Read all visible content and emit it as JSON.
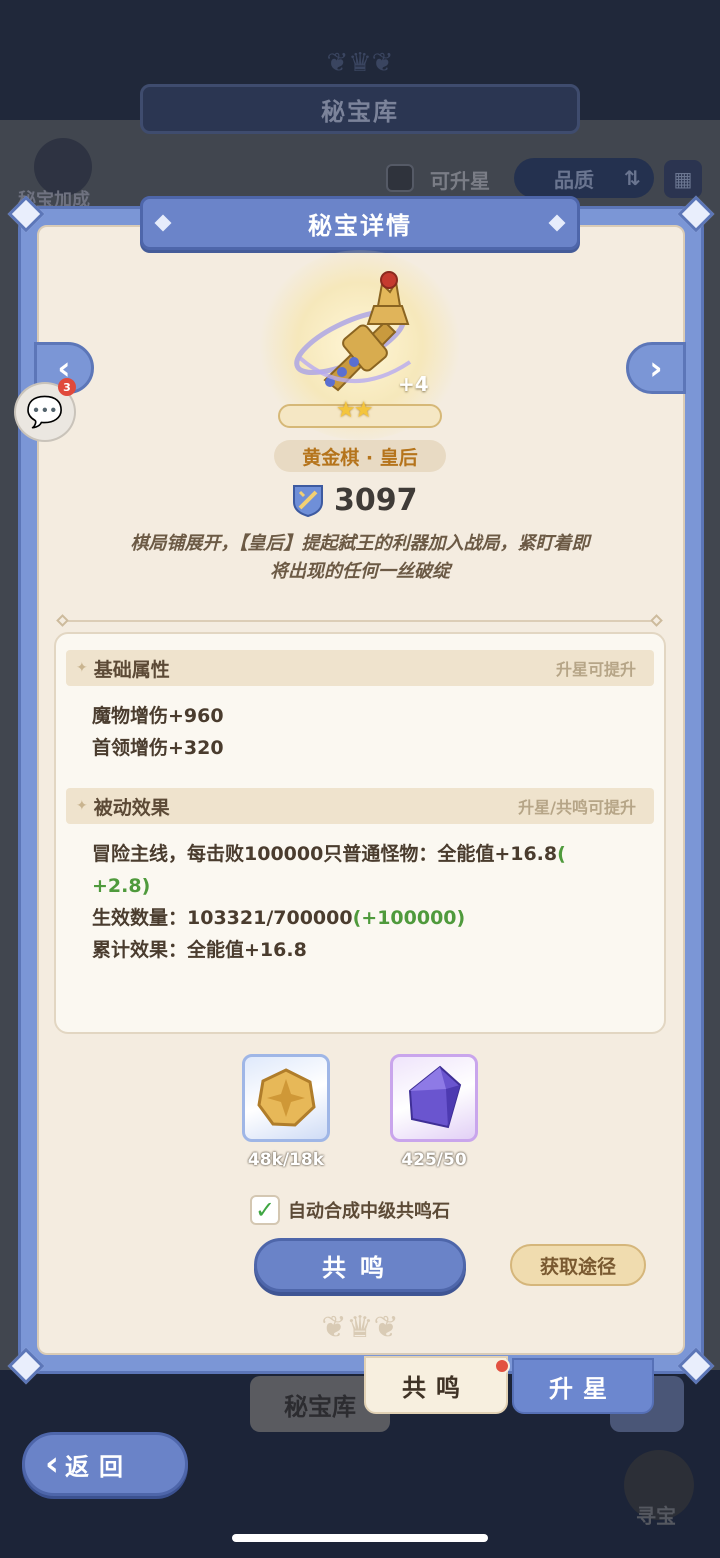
{
  "background": {
    "title": "秘宝库",
    "bonus_label": "秘宝加成",
    "filter_label": "可升星",
    "sort_label": "品质",
    "tab_left_label": "秘宝库",
    "hunt_label": "寻宝"
  },
  "modal": {
    "title": "秘宝详情",
    "item": {
      "name": "黄金棋 · 皇后",
      "level": "+4",
      "stars": "★★",
      "power": "3097",
      "description_line1": "棋局铺展开，【皇后】提起弑王的利器加入战局，紧盯着即",
      "description_line2": "将出现的任何一丝破绽"
    },
    "base_section": {
      "title": "基础属性",
      "hint": "升星可提升",
      "lines": [
        "魔物增伤+960",
        "首领增伤+320"
      ]
    },
    "passive_section": {
      "title": "被动效果",
      "hint": "升星/共鸣可提升",
      "line1_text": "冒险主线，每击败100000只普通怪物：全能值+16.8",
      "line1_paren_open": "(",
      "line1_bonus": "+2.8)",
      "line2_text": "生效数量：103321/700000",
      "line2_bonus": "(+100000)",
      "line3_text": "累计效果：全能值+16.8"
    },
    "materials": [
      {
        "name": "coin-material",
        "count": "48k/18k"
      },
      {
        "name": "gem-material",
        "count": "425/50"
      }
    ],
    "auto_synthesize_label": "自动合成中级共鸣石",
    "auto_synthesize_checked": true,
    "resonate_button": "共鸣",
    "source_button": "获取途径"
  },
  "tabs": {
    "resonate": "共鸣",
    "upgrade": "升星"
  },
  "chat": {
    "badge_count": "3"
  },
  "back_button": "返回",
  "colors": {
    "accent_blue": "#6a83c8",
    "panel_cream": "#f4ece0",
    "gold_text": "#b5741c",
    "bonus_green": "#4f9a3c",
    "badge_red": "#e0493c"
  }
}
